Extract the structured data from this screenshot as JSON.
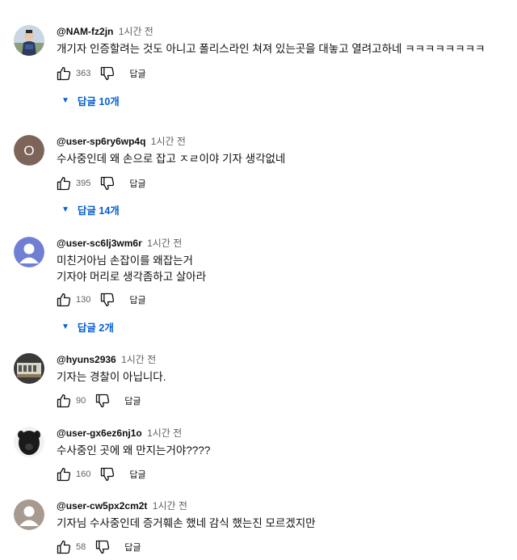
{
  "comments": [
    {
      "author": "@NAM-fz2jn",
      "time": "1시간 전",
      "lines": [
        "개기자 인증할려는 것도 아니고 폴리스라인 쳐져 있는곳을 대놓고 열려고하네 ㅋㅋㅋㅋㅋㅋㅋㅋ"
      ],
      "likes": "363",
      "reply_label": "답글",
      "replies_label": "답글 10개",
      "avatar": "photo-person"
    },
    {
      "author": "@user-sp6ry6wp4q",
      "time": "1시간 전",
      "lines": [
        "수사중인데 왜 손으로 잡고 ㅈㄹ이야 기자 생각없네"
      ],
      "likes": "395",
      "reply_label": "답글",
      "replies_label": "답글 14개",
      "avatar": "letter",
      "avatar_letter": "O",
      "avatar_color": "#7d6458"
    },
    {
      "author": "@user-sc6lj3wm6r",
      "time": "1시간 전",
      "lines": [
        "미친거아님 손잡이를 왜잡는거",
        "기자야 머리로 생각좀하고 살아라"
      ],
      "likes": "130",
      "reply_label": "답글",
      "replies_label": "답글 2개",
      "avatar": "default-user",
      "avatar_color": "#6f7fd4"
    },
    {
      "author": "@hyuns2936",
      "time": "1시간 전",
      "lines": [
        "기자는 경찰이 아닙니다."
      ],
      "likes": "90",
      "reply_label": "답글",
      "avatar": "photo-building"
    },
    {
      "author": "@user-gx6ez6nj1o",
      "time": "1시간 전",
      "lines": [
        "수사중인 곳에 왜 만지는거야????"
      ],
      "likes": "160",
      "reply_label": "답글",
      "avatar": "photo-animal"
    },
    {
      "author": "@user-cw5px2cm2t",
      "time": "1시간 전",
      "lines": [
        "기자님 수사중인데 증거훼손 했네 감식 했는진 모르겠지만"
      ],
      "likes": "58",
      "reply_label": "답글",
      "avatar": "default-user",
      "avatar_color": "#a89a8f"
    }
  ]
}
